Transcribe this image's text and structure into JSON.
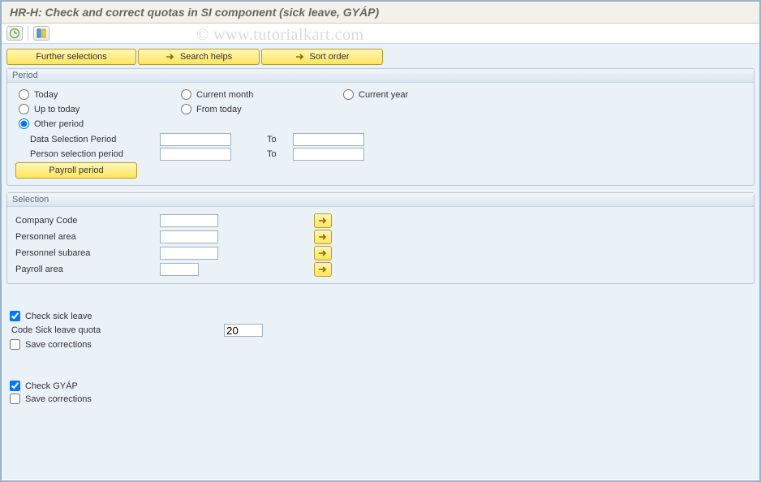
{
  "title": "HR-H: Check and correct quotas in SI component (sick leave, GYÁP)",
  "watermark": "© www.tutorialkart.com",
  "buttons": {
    "further_selections": "Further selections",
    "search_helps": "Search helps",
    "sort_order": "Sort order",
    "payroll_period": "Payroll period"
  },
  "period": {
    "title": "Period",
    "today": "Today",
    "current_month": "Current month",
    "current_year": "Current year",
    "up_to_today": "Up to today",
    "from_today": "From today",
    "other_period": "Other period",
    "data_selection_period": "Data Selection Period",
    "person_selection_period": "Person selection period",
    "to": "To",
    "data_from": "",
    "data_to": "",
    "person_from": "",
    "person_to": ""
  },
  "selection": {
    "title": "Selection",
    "company_code": "Company Code",
    "personnel_area": "Personnel area",
    "personnel_subarea": "Personnel subarea",
    "payroll_area": "Payroll area",
    "company_code_val": "",
    "personnel_area_val": "",
    "personnel_subarea_val": "",
    "payroll_area_val": ""
  },
  "checks": {
    "check_sick_leave": "Check sick leave",
    "code_sick_leave_quota": "Code Sick leave quota",
    "code_sick_leave_quota_val": "20",
    "save_corrections": "Save corrections",
    "check_gyap": "Check GYÁP"
  }
}
